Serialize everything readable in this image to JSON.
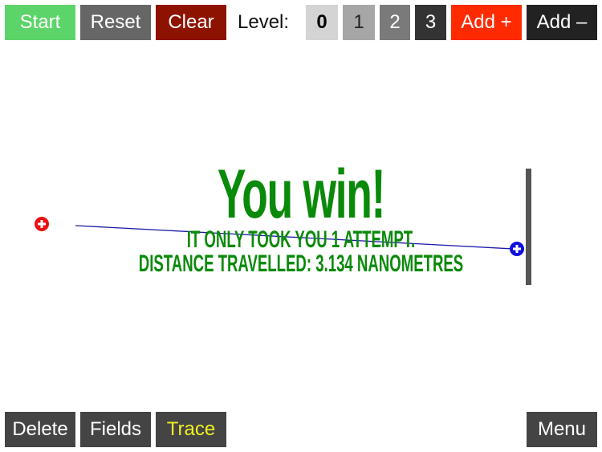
{
  "toolbar": {
    "start_label": "Start",
    "reset_label": "Reset",
    "clear_label": "Clear",
    "level_label": "Level:",
    "levels": [
      "0",
      "1",
      "2",
      "3"
    ],
    "selected_level": "0",
    "add_plus_label": "Add +",
    "add_minus_label": "Add –"
  },
  "bottom_bar": {
    "delete_label": "Delete",
    "fields_label": "Fields",
    "trace_label": "Trace",
    "menu_label": "Menu"
  },
  "game": {
    "title": "You win!",
    "attempts_text": "IT ONLY TOOK YOU 1 ATTEMPT.",
    "distance_text": "DISTANCE TRAVELLED: 3.134 NANOMETRES",
    "colors": {
      "win_text": "#0a8a0a",
      "positive_charge": "#ee1111",
      "negative_charge": "#1010dd",
      "trace_line": "#1a1aaa",
      "goal_bar": "#555555"
    },
    "charges": [
      {
        "type": "positive",
        "icon": "plus-icon"
      },
      {
        "type": "particle",
        "icon": "plus-icon"
      }
    ]
  }
}
